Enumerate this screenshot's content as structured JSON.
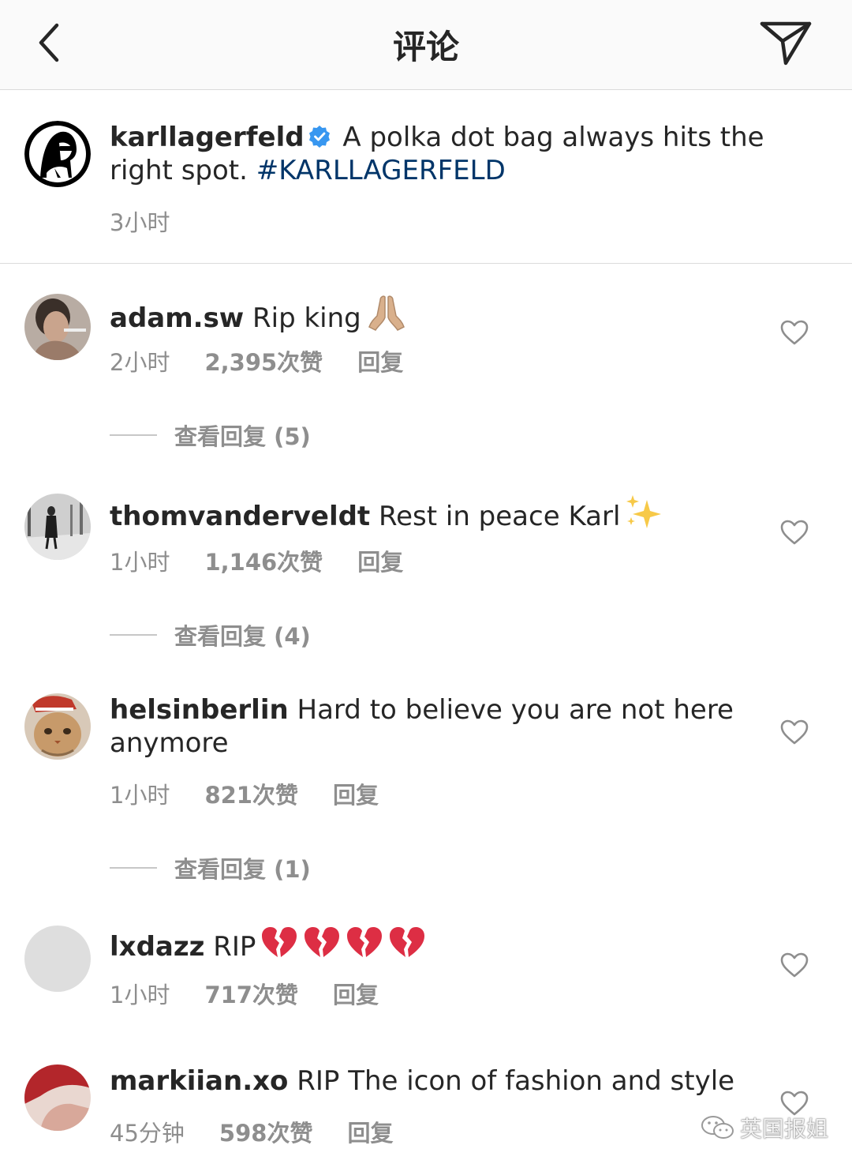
{
  "header": {
    "title": "评论"
  },
  "caption": {
    "username": "karllagerfeld",
    "text": "A polka dot bag always hits the right spot.",
    "hashtag": "#KARLLAGERFELD",
    "time": "3小时"
  },
  "comments": [
    {
      "username": "adam.sw",
      "text": "Rip king",
      "emoji": "🙏🏼",
      "time": "2小时",
      "likes": "2,395次赞",
      "reply": "回复",
      "view_replies": "查看回复 (5)"
    },
    {
      "username": "thomvanderveldt",
      "text": "Rest in peace Karl",
      "emoji": "✨",
      "time": "1小时",
      "likes": "1,146次赞",
      "reply": "回复",
      "view_replies": "查看回复 (4)"
    },
    {
      "username": "helsinberlin",
      "text": "Hard to believe you are not here anymore",
      "time": "1小时",
      "likes": "821次赞",
      "reply": "回复",
      "view_replies": "查看回复 (1)"
    },
    {
      "username": "lxdazz",
      "text": "RIP",
      "emoji": "💔💔💔💔",
      "time": "1小时",
      "likes": "717次赞",
      "reply": "回复"
    },
    {
      "username": "markiian.xo",
      "text": "RIP The icon of fashion and style",
      "time": "45分钟",
      "likes": "598次赞",
      "reply": "回复"
    }
  ],
  "watermark": {
    "text": "英国报姐"
  },
  "colors": {
    "link": "#003569",
    "verified": "#3897f0",
    "secondary": "#8e8e8e",
    "divider": "#dbdbdb"
  },
  "icons": [
    "back-chevron-icon",
    "send-icon",
    "verified-badge-icon",
    "heart-icon",
    "wechat-icon"
  ]
}
